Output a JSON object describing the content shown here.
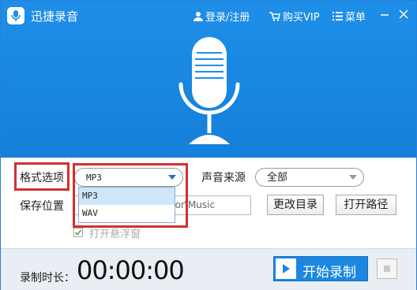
{
  "app": {
    "title": "迅捷录音"
  },
  "titlebar": {
    "login_label": "登录/注册",
    "vip_label": "购买VIP",
    "menu_label": "菜单",
    "icons": [
      "user-icon",
      "cart-icon",
      "menu-icon",
      "minimize-icon",
      "close-icon"
    ]
  },
  "settings": {
    "format_label": "格式选项",
    "format_value": "MP3",
    "format_options": [
      "MP3",
      "WAV"
    ],
    "source_label": "声音来源",
    "source_value": "全部",
    "save_label": "保存位置",
    "save_path": "C:\\Users\\Administrator\\Music",
    "change_dir_label": "更改目录",
    "open_path_label": "打开路径",
    "float_window_label": "打开悬浮窗",
    "float_window_checked": true
  },
  "bottom": {
    "duration_label": "录制时长：",
    "timer": "00:00:00",
    "start_label": "开始录制"
  },
  "colors": {
    "accent": "#1c87e0",
    "highlight": "#d23030"
  }
}
